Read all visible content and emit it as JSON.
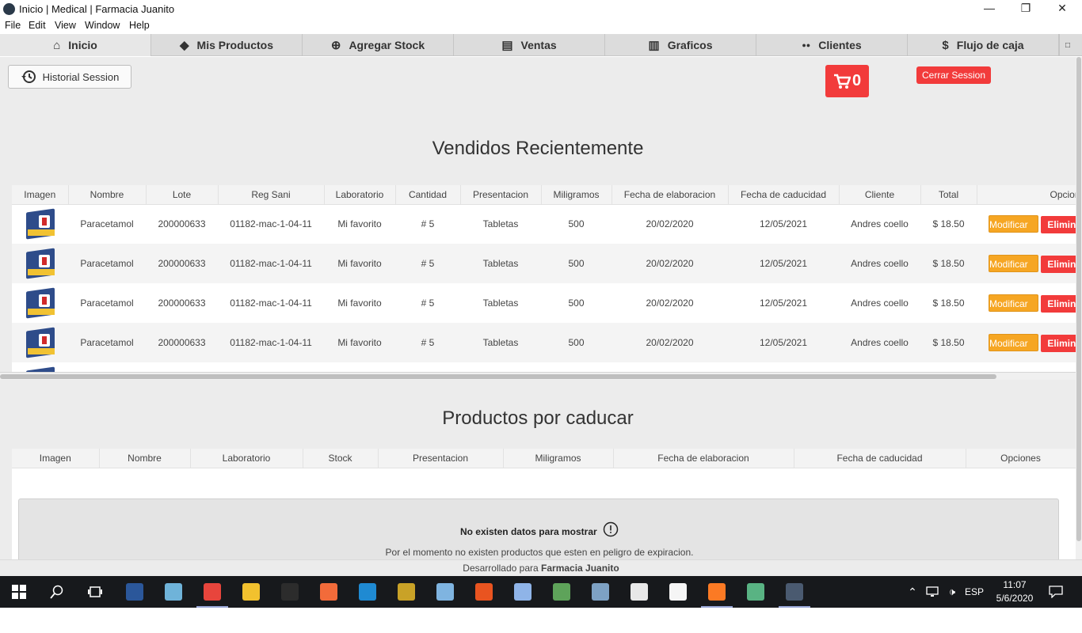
{
  "window": {
    "title": "Inicio | Medical | Farmacia Juanito",
    "minimize": "—",
    "restore": "❐",
    "close": "✕"
  },
  "menu": [
    "File",
    "Edit",
    "View",
    "Window",
    "Help"
  ],
  "nav": [
    {
      "label": "Inicio",
      "icon": "home-icon",
      "glyph": "⌂"
    },
    {
      "label": "Mis Productos",
      "icon": "tag-icon",
      "glyph": "◆"
    },
    {
      "label": "Agregar Stock",
      "icon": "plus-circle-icon",
      "glyph": "⊕"
    },
    {
      "label": "Ventas",
      "icon": "store-icon",
      "glyph": "▤"
    },
    {
      "label": "Graficos",
      "icon": "chart-icon",
      "glyph": "▥"
    },
    {
      "label": "Clientes",
      "icon": "users-icon",
      "glyph": "●●"
    },
    {
      "label": "Flujo de caja",
      "icon": "dollar-icon",
      "glyph": "$"
    }
  ],
  "actions": {
    "history_label": "Historial Session",
    "cart_count": "0",
    "logout_label": "Cerrar Session"
  },
  "recent": {
    "title": "Vendidos Recientemente",
    "columns": [
      "Imagen",
      "Nombre",
      "Lote",
      "Reg Sani",
      "Laboratorio",
      "Cantidad",
      "Presentacion",
      "Miligramos",
      "Fecha de elaboracion",
      "Fecha de caducidad",
      "Cliente",
      "Total",
      "Opciones"
    ],
    "rows": [
      {
        "nombre": "Paracetamol",
        "lote": "200000633",
        "reg": "01182-mac-1-04-11",
        "lab": "Mi favorito",
        "cantidad": "# 5",
        "presentacion": "Tabletas",
        "mg": "500",
        "elab": "20/02/2020",
        "cad": "12/05/2021",
        "cliente": "Andres coello",
        "total": "$ 18.50"
      },
      {
        "nombre": "Paracetamol",
        "lote": "200000633",
        "reg": "01182-mac-1-04-11",
        "lab": "Mi favorito",
        "cantidad": "# 5",
        "presentacion": "Tabletas",
        "mg": "500",
        "elab": "20/02/2020",
        "cad": "12/05/2021",
        "cliente": "Andres coello",
        "total": "$ 18.50"
      },
      {
        "nombre": "Paracetamol",
        "lote": "200000633",
        "reg": "01182-mac-1-04-11",
        "lab": "Mi favorito",
        "cantidad": "# 5",
        "presentacion": "Tabletas",
        "mg": "500",
        "elab": "20/02/2020",
        "cad": "12/05/2021",
        "cliente": "Andres coello",
        "total": "$ 18.50"
      },
      {
        "nombre": "Paracetamol",
        "lote": "200000633",
        "reg": "01182-mac-1-04-11",
        "lab": "Mi favorito",
        "cantidad": "# 5",
        "presentacion": "Tabletas",
        "mg": "500",
        "elab": "20/02/2020",
        "cad": "12/05/2021",
        "cliente": "Andres coello",
        "total": "$ 18.50"
      }
    ],
    "modify_label": "Modificar",
    "delete_label": "Eliminar"
  },
  "expiring": {
    "title": "Productos por caducar",
    "columns": [
      "Imagen",
      "Nombre",
      "Laboratorio",
      "Stock",
      "Presentacion",
      "Miligramos",
      "Fecha de elaboracion",
      "Fecha de caducidad",
      "Opciones"
    ],
    "empty_title": "No existen datos para mostrar",
    "empty_text": "Por el momento no existen productos que esten en peligro de expiracion."
  },
  "footer": {
    "prefix": "Desarrollado para",
    "brand": "Farmacia Juanito"
  },
  "taskbar": {
    "apps": [
      {
        "name": "word-icon",
        "color": "#2b579a"
      },
      {
        "name": "notepad-icon",
        "color": "#6fb3d9"
      },
      {
        "name": "chrome-icon",
        "color": "#e8453c"
      },
      {
        "name": "file-explorer-icon",
        "color": "#f2c12e"
      },
      {
        "name": "terminal-icon",
        "color": "#2c2c2c"
      },
      {
        "name": "postman-icon",
        "color": "#f26b3a"
      },
      {
        "name": "vscode-icon",
        "color": "#1f8ad2"
      },
      {
        "name": "git-icon",
        "color": "#c9a227"
      },
      {
        "name": "box-icon",
        "color": "#7fb4e0"
      },
      {
        "name": "ubuntu-icon",
        "color": "#e95420"
      },
      {
        "name": "virtualbox-icon",
        "color": "#8fb4e8"
      },
      {
        "name": "android-studio-icon",
        "color": "#5ea35a"
      },
      {
        "name": "postgres-icon",
        "color": "#7da1c4"
      },
      {
        "name": "slack-icon",
        "color": "#e8e8e8"
      },
      {
        "name": "notion-icon",
        "color": "#f5f5f5"
      },
      {
        "name": "xampp-icon",
        "color": "#fb7a24"
      },
      {
        "name": "gitkraken-icon",
        "color": "#59b383"
      },
      {
        "name": "electron-icon",
        "color": "#4a5a70"
      }
    ],
    "lang": "ESP",
    "time": "11:07",
    "date": "5/6/2020"
  }
}
